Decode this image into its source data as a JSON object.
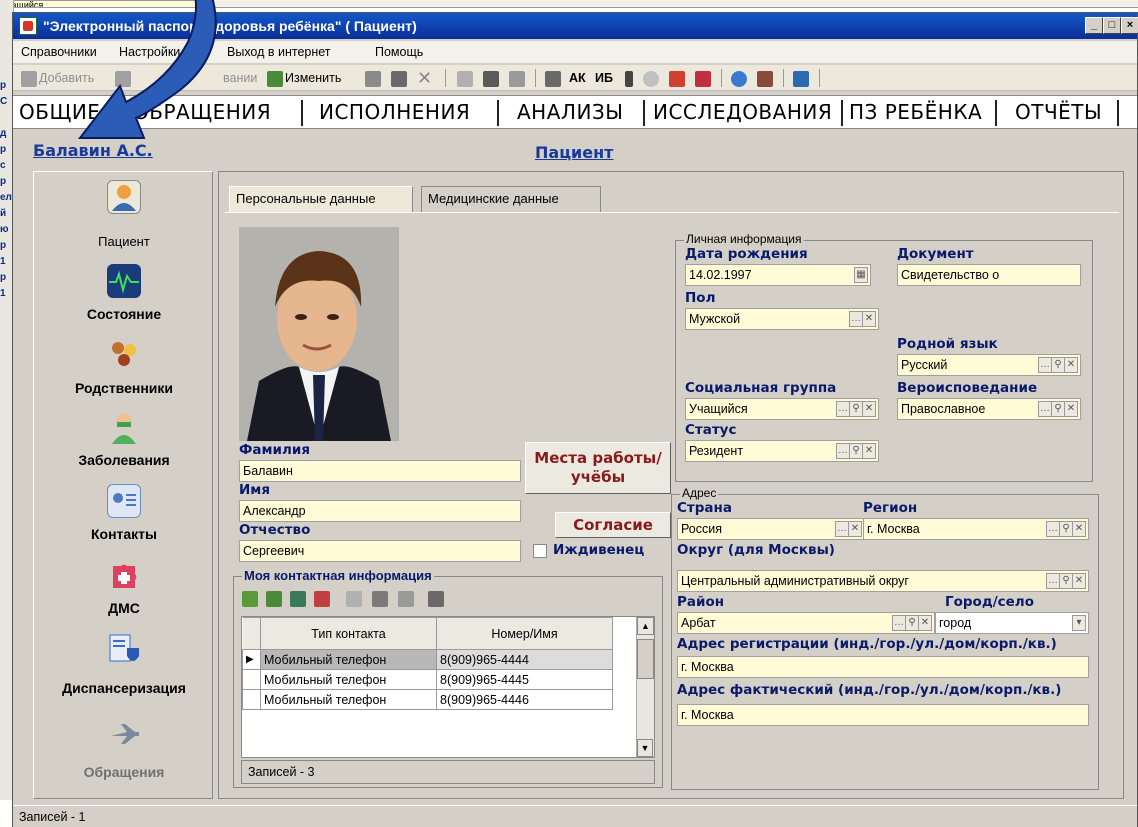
{
  "background": {
    "top_cell": "Учащийся",
    "left_letters": [
      "р",
      "С",
      "",
      "д",
      "р",
      "с",
      "р",
      "ел",
      "й",
      "ю",
      "р",
      "1",
      "р",
      "1"
    ]
  },
  "window": {
    "title": "\"Электронный паспорт здоровья ребёнка\" ( Пациент)",
    "btn_min": "_",
    "btn_max": "□",
    "btn_close": "×"
  },
  "menu": [
    "Справочники",
    "Настройки",
    "Выход в интернет",
    "Помощь"
  ],
  "toolbar": {
    "add": "Добавить",
    "hidden": "вании",
    "edit": "Изменить",
    "ak": "АК",
    "ib": "ИБ"
  },
  "nav_tabs": [
    "ОБЩИЕ",
    "ОБРАЩЕНИЯ",
    "ИСПОЛНЕНИЯ",
    "АНАЛИЗЫ",
    "ИССЛЕДОВАНИЯ",
    "ПЗ РЕБЁНКА",
    "ОТЧЁТЫ"
  ],
  "user_link": "Балавин А.С.",
  "page_title": "Пациент",
  "sidebar": {
    "items": [
      {
        "label": "Пациент",
        "icon": "patient-icon",
        "color": "#f0a040"
      },
      {
        "label": "Состояние",
        "icon": "monitor-icon",
        "color": "#2a6ab0"
      },
      {
        "label": "Родственники",
        "icon": "family-icon",
        "color": "#c07030"
      },
      {
        "label": "Заболевания",
        "icon": "doctor-icon",
        "color": "#40a050"
      },
      {
        "label": "Контакты",
        "icon": "contact-card-icon",
        "color": "#4a7ac0"
      },
      {
        "label": "ДМС",
        "icon": "insurance-puzzle-icon",
        "color": "#e04060"
      },
      {
        "label": "Диспансеризация",
        "icon": "dispensary-shield-icon",
        "color": "#3a6ad0"
      },
      {
        "label": "Обращения",
        "icon": "plane-arrow-icon",
        "color": "#8090a0"
      }
    ]
  },
  "tabs": [
    "Персональные данные",
    "Медицинские данные"
  ],
  "personal": {
    "surname_label": "Фамилия",
    "surname": "Балавин",
    "name_label": "Имя",
    "name": "Александр",
    "patronymic_label": "Отчество",
    "patronymic": "Сергеевич",
    "dependent_label": "Иждивенец",
    "places_button": "Места работы/учёбы",
    "consent_button": "Согласие"
  },
  "contacts": {
    "title": "Моя контактная информация",
    "col_type": "Тип контакта",
    "col_number": "Номер/Имя",
    "rows": [
      {
        "type": "Мобильный телефон",
        "number": "8(909)965-4444"
      },
      {
        "type": "Мобильный телефон",
        "number": "8(909)965-4445"
      },
      {
        "type": "Мобильный телефон",
        "number": "8(909)965-4446"
      }
    ],
    "records": "Записей - 3"
  },
  "personal_info": {
    "title": "Личная информация",
    "birth_label": "Дата рождения",
    "birth": "14.02.1997",
    "document_label": "Документ",
    "document": "Свидетельство о",
    "sex_label": "Пол",
    "sex": "Мужской",
    "language_label": "Родной язык",
    "language": "Русский",
    "social_label": "Социальная группа",
    "social": "Учащийся",
    "religion_label": "Вероисповедание",
    "religion": "Православное",
    "status_label": "Статус",
    "status": "Резидент"
  },
  "address": {
    "title": "Адрес",
    "country_label": "Страна",
    "country": "Россия",
    "region_label": "Регион",
    "region": "г. Москва",
    "district_label": "Округ (для Москвы)",
    "district": "Центральный административный округ",
    "area_label": "Район",
    "area": "Арбат",
    "settlement_label": "Город/село",
    "settlement": "город",
    "reg_label": "Адрес регистрации (инд./гор./ул./дом/корп./кв.)",
    "reg": "г. Москва",
    "fact_label": "Адрес фактический (инд./гор./ул./дом/корп./кв.)",
    "fact": "г. Москва"
  },
  "statusbar": "Записей - 1",
  "colors": {
    "title_bar": "#0a2e9a",
    "field_bg": "#fffbd6",
    "label": "#0a1a6a",
    "link": "#1a3a9a",
    "button_text": "#8a1a1a",
    "arrow": "#2a5cb8"
  }
}
